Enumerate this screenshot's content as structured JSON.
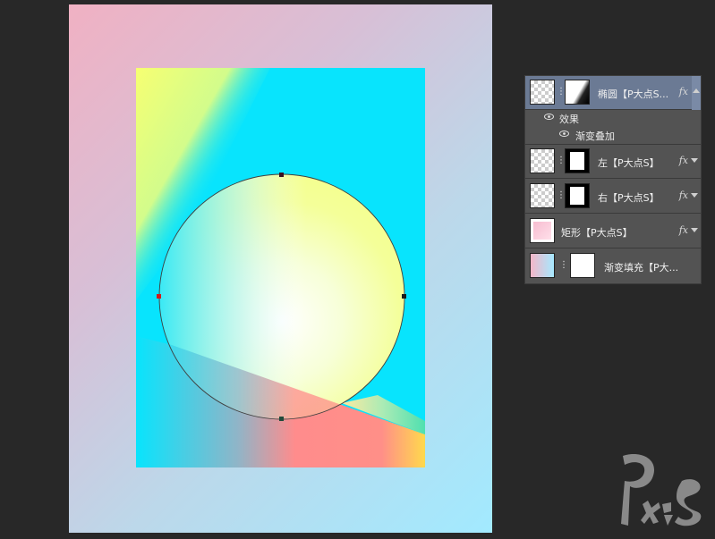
{
  "layers_panel": {
    "layers": [
      {
        "name": "椭圆【P大点S...",
        "selected": true,
        "has_fx": true
      },
      {
        "name": "左【P大点S】",
        "selected": false,
        "has_fx": true
      },
      {
        "name": "右【P大点S】",
        "selected": false,
        "has_fx": true
      },
      {
        "name": "矩形【P大点S】",
        "selected": false,
        "has_fx": true
      },
      {
        "name": "渐变填充【P大...",
        "selected": false,
        "has_fx": false
      }
    ],
    "effects": {
      "group_label": "效果",
      "items": [
        "渐变叠加"
      ]
    },
    "fx_label": "fx"
  },
  "watermark": {
    "text": "PS",
    "sub": "大点"
  },
  "colors": {
    "canvas_bg": "#282828",
    "panel_bg": "#535353",
    "selected_layer": "#6b7a94",
    "artboard_cyan": "#08e4fd"
  },
  "icons": [
    "eye-icon",
    "chain-link-icon",
    "fx-icon",
    "scroll-arrow-icon"
  ]
}
